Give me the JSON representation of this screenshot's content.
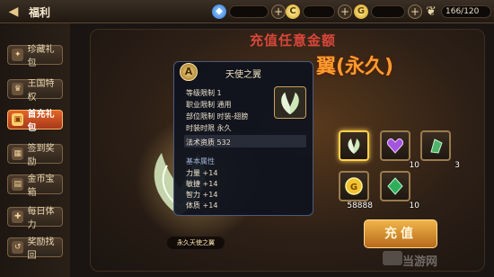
{
  "header": {
    "title": "福利",
    "stamina": "166/120"
  },
  "sidebar": {
    "items": [
      {
        "label": "珍藏礼包"
      },
      {
        "label": "王国特权"
      },
      {
        "label": "首充礼包"
      },
      {
        "label": "签到奖励"
      },
      {
        "label": "金币宝箱"
      },
      {
        "label": "每日体力"
      },
      {
        "label": "奖励找回"
      }
    ]
  },
  "main": {
    "headline_top": "充值任意金额",
    "headline_main": "翼(永久)",
    "wing_label": "永久天使之翼",
    "recharge_label": "充值"
  },
  "rewards": [
    {
      "name": "wing",
      "count": ""
    },
    {
      "name": "heart-gem",
      "count": "10"
    },
    {
      "name": "green-crystal",
      "count": "3"
    },
    {
      "name": "gold-coin",
      "count": "58888"
    },
    {
      "name": "emerald",
      "count": "10"
    }
  ],
  "tooltip": {
    "badge": "A",
    "title": "天使之翼",
    "rows": [
      {
        "label": "等级限制",
        "value": "1"
      },
      {
        "label": "职业限制",
        "value": "通用"
      },
      {
        "label": "部位限制",
        "value": "时装-翅膀"
      },
      {
        "label": "时装时限",
        "value": "永久"
      },
      {
        "label": "法术资质",
        "value": "532"
      }
    ],
    "section_title": "基本属性",
    "stats": [
      {
        "label": "力量",
        "value": "+14"
      },
      {
        "label": "敏捷",
        "value": "+14"
      },
      {
        "label": "智力",
        "value": "+14"
      },
      {
        "label": "体质",
        "value": "+14"
      }
    ]
  },
  "watermark": "当游网",
  "colors": {
    "accent": "#ff9b2e",
    "active_tab": "#e2662a",
    "headline_red": "#d9473b"
  }
}
